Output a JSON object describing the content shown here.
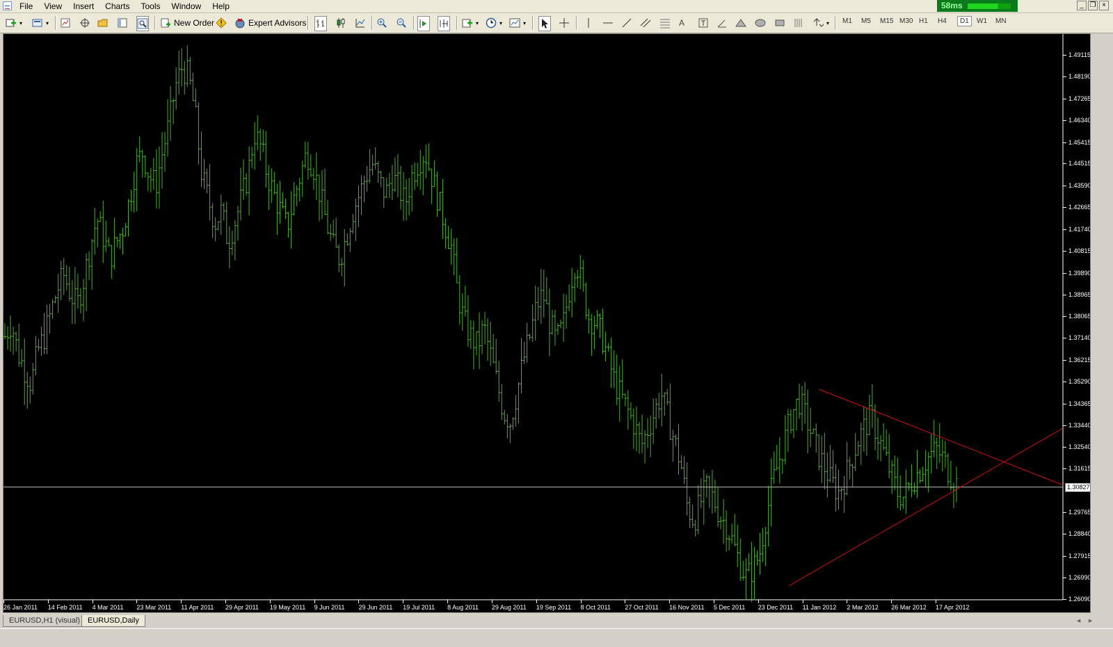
{
  "menu": [
    "File",
    "View",
    "Insert",
    "Charts",
    "Tools",
    "Window",
    "Help"
  ],
  "ping": "58ms",
  "toolbar": {
    "new_order": "New Order",
    "expert_advisors": "Expert Advisors",
    "timeframes": [
      "M1",
      "M5",
      "M15",
      "M30",
      "H1",
      "H4",
      "D1",
      "W1",
      "MN"
    ],
    "active_timeframe": "D1"
  },
  "chart": {
    "symbol": "EURUSD",
    "timeframe": "Daily",
    "background": "#000000",
    "bar_color": "#4caf30",
    "trendline_color": "#d01010",
    "price_axis": [
      "1.49115",
      "1.48190",
      "1.47265",
      "1.46340",
      "1.45415",
      "1.44515",
      "1.43590",
      "1.42665",
      "1.41740",
      "1.40815",
      "1.39890",
      "1.38965",
      "1.38065",
      "1.37140",
      "1.36215",
      "1.35290",
      "1.34365",
      "1.33440",
      "1.32540",
      "1.31615",
      "1.30827",
      "1.29765",
      "1.28840",
      "1.27915",
      "1.26990",
      "1.26090"
    ],
    "current_price": "1.30827",
    "date_axis": [
      "26 Jan 2011",
      "14 Feb 2011",
      "4 Mar 2011",
      "23 Mar 2011",
      "11 Apr 2011",
      "29 Apr 2011",
      "19 May 2011",
      "9 Jun 2011",
      "29 Jun 2011",
      "19 Jul 2011",
      "8 Aug 2011",
      "29 Aug 2011",
      "19 Sep 2011",
      "8 Oct 2011",
      "27 Oct 2011",
      "16 Nov 2011",
      "5 Dec 2011",
      "23 Dec 2011",
      "11 Jan 2012",
      "2 Mar 2012",
      "26 Mar 2012",
      "17 Apr 2012"
    ],
    "series_close_approx": [
      1.372,
      1.378,
      1.365,
      1.358,
      1.352,
      1.366,
      1.372,
      1.382,
      1.392,
      1.398,
      1.39,
      1.385,
      1.396,
      1.41,
      1.422,
      1.414,
      1.405,
      1.412,
      1.418,
      1.43,
      1.445,
      1.45,
      1.44,
      1.436,
      1.45,
      1.462,
      1.478,
      1.486,
      1.482,
      1.466,
      1.44,
      1.43,
      1.42,
      1.425,
      1.412,
      1.42,
      1.43,
      1.44,
      1.458,
      1.452,
      1.44,
      1.432,
      1.425,
      1.418,
      1.43,
      1.44,
      1.45,
      1.444,
      1.432,
      1.42,
      1.41,
      1.405,
      1.414,
      1.425,
      1.432,
      1.44,
      1.445,
      1.438,
      1.432,
      1.44,
      1.435,
      1.428,
      1.44,
      1.446,
      1.45,
      1.44,
      1.43,
      1.42,
      1.41,
      1.39,
      1.378,
      1.372,
      1.368,
      1.376,
      1.364,
      1.352,
      1.34,
      1.336,
      1.348,
      1.362,
      1.372,
      1.385,
      1.39,
      1.378,
      1.37,
      1.376,
      1.392,
      1.405,
      1.392,
      1.38,
      1.378,
      1.372,
      1.362,
      1.352,
      1.346,
      1.34,
      1.334,
      1.326,
      1.333,
      1.34,
      1.348,
      1.338,
      1.328,
      1.318,
      1.3,
      1.294,
      1.302,
      1.308,
      1.303,
      1.296,
      1.292,
      1.284,
      1.276,
      1.27,
      1.274,
      1.28,
      1.296,
      1.31,
      1.32,
      1.33,
      1.34,
      1.345,
      1.338,
      1.33,
      1.322,
      1.316,
      1.31,
      1.306,
      1.312,
      1.32,
      1.328,
      1.334,
      1.338,
      1.33,
      1.322,
      1.314,
      1.306,
      1.304,
      1.31,
      1.314,
      1.318,
      1.322,
      1.324,
      1.32,
      1.314,
      1.31
    ]
  },
  "tabs": [
    "EURUSD,H1 (visual)",
    "EURUSD,Daily"
  ],
  "active_tab": "EURUSD,Daily"
}
